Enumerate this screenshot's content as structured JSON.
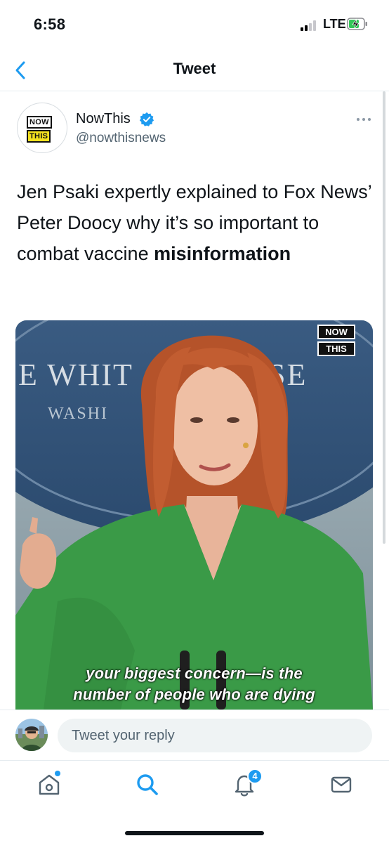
{
  "status_bar": {
    "time": "6:58",
    "network": "LTE"
  },
  "nav": {
    "title": "Tweet"
  },
  "tweet": {
    "author_name": "NowThis",
    "handle": "@nowthisnews",
    "logo": {
      "line1": "NOW",
      "line2": "THIS"
    },
    "text_part1": "Jen Psaki expertly explained to Fox News’ Peter Doocy why it’s so important to combat vaccine",
    "text_part2": "misinformation",
    "media": {
      "watermark_line1": "NOW",
      "watermark_line2": "THIS",
      "caption_line1": "your biggest concern—is the",
      "caption_line2": "number of people who are dying",
      "backdrop_text_1": "E WHIT",
      "backdrop_text_2": "SE",
      "backdrop_text_3": "WASHI"
    }
  },
  "reply": {
    "placeholder": "Tweet your reply"
  },
  "tab_bar": {
    "notifications_count": "4"
  },
  "colors": {
    "accent": "#1d9bf0",
    "text": "#0f1419",
    "secondary_text": "#536471",
    "logo_yellow": "#f5e21f",
    "dress_green": "#3a9a47"
  }
}
